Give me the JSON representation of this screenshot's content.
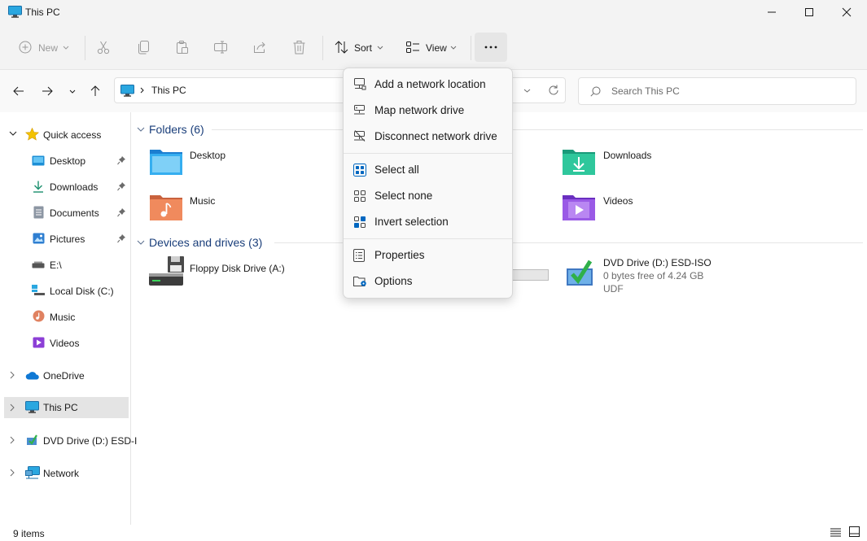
{
  "window": {
    "title": "This PC",
    "accent": "#0067c0"
  },
  "toolbar": {
    "new_label": "New",
    "sort_label": "Sort",
    "view_label": "View",
    "icons": [
      "cut-icon",
      "copy-icon",
      "paste-icon",
      "rename-icon",
      "share-icon",
      "delete-icon"
    ]
  },
  "address": {
    "path": "This PC"
  },
  "search": {
    "placeholder": "Search This PC"
  },
  "sidebar": {
    "items": [
      {
        "label": "Quick access"
      },
      {
        "label": "Desktop"
      },
      {
        "label": "Downloads"
      },
      {
        "label": "Documents"
      },
      {
        "label": "Pictures"
      },
      {
        "label": "E:\\"
      },
      {
        "label": "Local Disk (C:)"
      },
      {
        "label": "Music"
      },
      {
        "label": "Videos"
      },
      {
        "label": "OneDrive"
      },
      {
        "label": "This PC"
      },
      {
        "label": "DVD Drive (D:) ESD-I"
      },
      {
        "label": "Network"
      }
    ]
  },
  "main": {
    "folders_header": "Folders (6)",
    "devices_header": "Devices and drives (3)",
    "folders": [
      {
        "label": "Desktop"
      },
      {
        "label": "Downloads"
      },
      {
        "label": "Music"
      },
      {
        "label": "Videos"
      }
    ],
    "drives": [
      {
        "label": "Floppy Disk Drive (A:)"
      },
      {
        "label": "DVD Drive (D:) ESD-ISO",
        "free": "0 bytes free of 4.24 GB",
        "fs": "UDF"
      }
    ]
  },
  "menu": {
    "items": [
      {
        "label": "Add a network location"
      },
      {
        "label": "Map network drive"
      },
      {
        "label": "Disconnect network drive"
      },
      {
        "label": "Select all"
      },
      {
        "label": "Select none"
      },
      {
        "label": "Invert selection"
      },
      {
        "label": "Properties"
      },
      {
        "label": "Options"
      }
    ]
  },
  "status": {
    "items": "9 items"
  }
}
